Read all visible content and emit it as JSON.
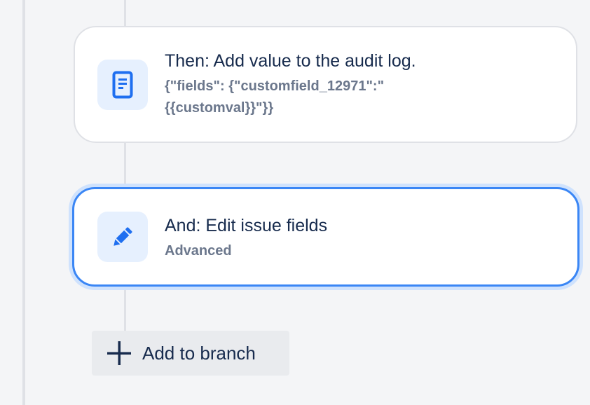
{
  "audit_card": {
    "title": "Then: Add value to the audit log.",
    "detail": "{\"fields\": {\"customfield_12971\":\"\n{{customval}}\"}}",
    "icon": "document-icon"
  },
  "edit_card": {
    "title": "And: Edit issue fields",
    "detail": "Advanced",
    "icon": "pencil-icon",
    "selected": true
  },
  "add_branch": {
    "label": "Add to branch",
    "icon": "plus-icon"
  },
  "colors": {
    "accent": "#3a86f5",
    "selection_glow": "#cfe2fd",
    "icon_bg": "#e6f0fe",
    "text_primary": "#172b4d",
    "text_secondary": "#6b778c",
    "canvas": "#f4f5f7"
  }
}
